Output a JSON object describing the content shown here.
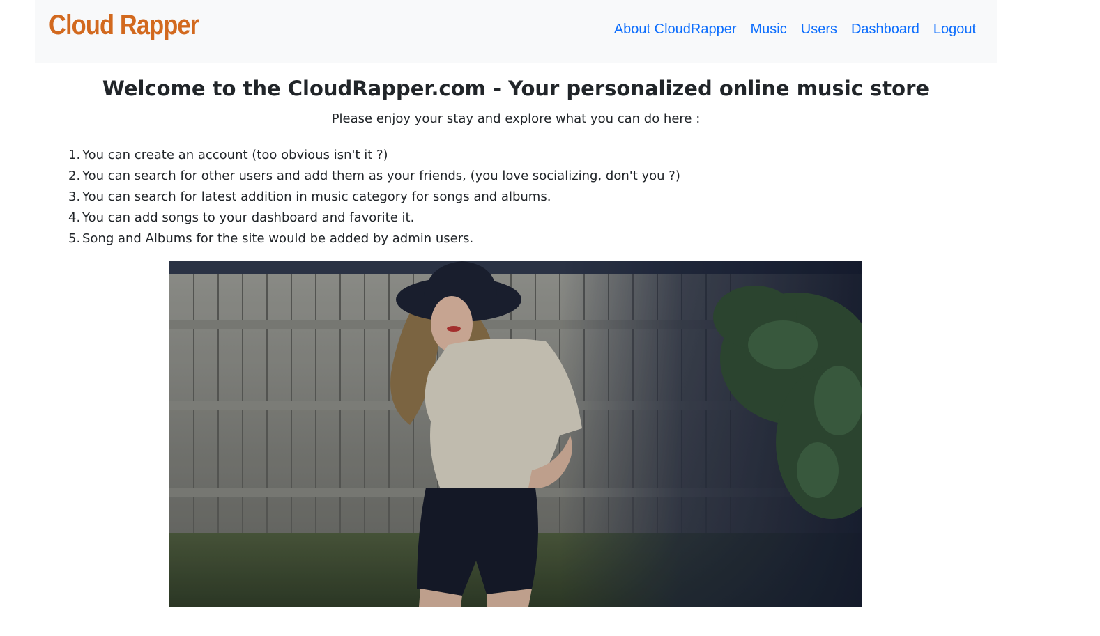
{
  "brand": {
    "name": "Cloud Rapper",
    "color": "#d2691e"
  },
  "nav": {
    "links": [
      {
        "label": "About CloudRapper"
      },
      {
        "label": "Music"
      },
      {
        "label": "Users"
      },
      {
        "label": "Dashboard"
      },
      {
        "label": "Logout"
      }
    ],
    "link_color": "#0d6efd"
  },
  "main": {
    "title": "Welcome to the CloudRapper.com - Your personalized online music store",
    "subtitle": "Please enjoy your stay and explore what you can do here :",
    "features": [
      {
        "num": "1.",
        "text": "You can create an account (too obvious isn't it ?)"
      },
      {
        "num": "2.",
        "text": "You can search for other users and add them as your friends, (you love socializing, don't you ?)"
      },
      {
        "num": "3.",
        "text": "You can search for latest addition in music category for songs and albums."
      },
      {
        "num": "4.",
        "text": "You can add songs to your dashboard and favorite it."
      },
      {
        "num": "5.",
        "text": "Song and Albums for the site would be added by admin users."
      }
    ]
  }
}
